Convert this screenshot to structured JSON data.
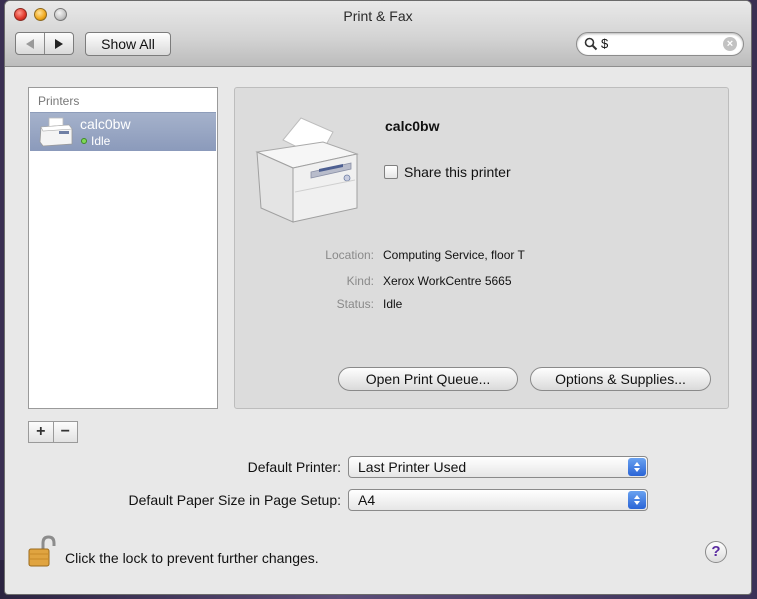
{
  "window": {
    "title": "Print & Fax",
    "show_all_label": "Show All",
    "search": {
      "value": "$"
    }
  },
  "printers_list": {
    "header": "Printers",
    "items": [
      {
        "name": "calc0bw",
        "status": "Idle",
        "selected": true
      }
    ]
  },
  "list_controls": {
    "add_label": "+",
    "remove_label": "−"
  },
  "detail": {
    "printer_name": "calc0bw",
    "share_label": "Share this printer",
    "share_checked": false,
    "fields": [
      {
        "label": "Location:",
        "value": "Computing Service, floor T"
      },
      {
        "label": "Kind:",
        "value": "Xerox WorkCentre 5665"
      },
      {
        "label": "Status:",
        "value": "Idle"
      }
    ],
    "open_queue_label": "Open Print Queue...",
    "options_label": "Options & Supplies..."
  },
  "settings": {
    "default_printer_label": "Default Printer:",
    "default_printer_value": "Last Printer Used",
    "paper_size_label": "Default Paper Size in Page Setup:",
    "paper_size_value": "A4"
  },
  "footer": {
    "lock_text": "Click the lock to prevent further changes.",
    "help_label": "?"
  },
  "colors": {
    "selection": "#8b9abb",
    "stepper": "#2a64d6",
    "status_dot": "#7ed957"
  }
}
